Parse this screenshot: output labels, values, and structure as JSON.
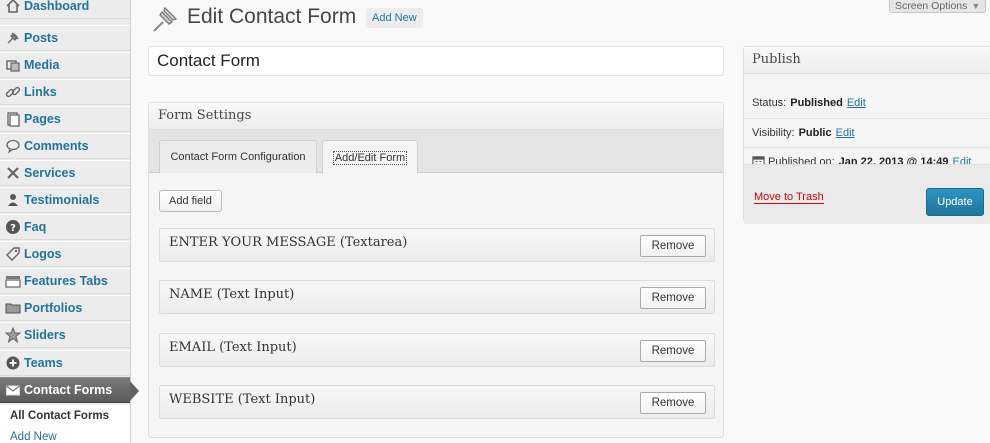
{
  "sidebar": {
    "items": [
      {
        "label": "Dashboard",
        "icon": "home-icon"
      },
      {
        "label": "Posts",
        "icon": "pushpin-icon"
      },
      {
        "label": "Media",
        "icon": "media-icon"
      },
      {
        "label": "Links",
        "icon": "link-icon"
      },
      {
        "label": "Pages",
        "icon": "pages-icon"
      },
      {
        "label": "Comments",
        "icon": "comment-icon"
      },
      {
        "label": "Services",
        "icon": "tools-icon"
      },
      {
        "label": "Testimonials",
        "icon": "user-icon"
      },
      {
        "label": "Faq",
        "icon": "question-icon"
      },
      {
        "label": "Logos",
        "icon": "tag-icon"
      },
      {
        "label": "Features Tabs",
        "icon": "tabs-icon"
      },
      {
        "label": "Portfolios",
        "icon": "folder-icon"
      },
      {
        "label": "Sliders",
        "icon": "star-icon"
      },
      {
        "label": "Teams",
        "icon": "plus-circle-icon"
      },
      {
        "label": "Contact Forms",
        "icon": "envelope-icon",
        "current": true
      }
    ],
    "submenu": [
      {
        "label": "All Contact Forms"
      },
      {
        "label": "Add New"
      }
    ]
  },
  "header": {
    "title": "Edit Contact Form",
    "add_new_label": "Add New",
    "screen_options_label": "Screen Options"
  },
  "title_field": {
    "value": "Contact Form"
  },
  "form_settings": {
    "title": "Form Settings",
    "tabs": [
      {
        "label": "Contact Form Configuration",
        "active": false
      },
      {
        "label": "Add/Edit Form",
        "active": true
      }
    ],
    "add_field_label": "Add field",
    "fields": [
      {
        "label": "ENTER YOUR MESSAGE (Textarea)",
        "remove_label": "Remove"
      },
      {
        "label": "NAME (Text Input)",
        "remove_label": "Remove"
      },
      {
        "label": "EMAIL (Text Input)",
        "remove_label": "Remove"
      },
      {
        "label": "WEBSITE (Text Input)",
        "remove_label": "Remove"
      }
    ]
  },
  "publish": {
    "title": "Publish",
    "status_label": "Status:",
    "status_value": "Published",
    "visibility_label": "Visibility:",
    "visibility_value": "Public",
    "published_on_label": "Published on:",
    "published_on_value": "Jan 22, 2013 @ 14:49",
    "edit_label": "Edit",
    "move_to_trash_label": "Move to Trash",
    "update_label": "Update"
  },
  "colors": {
    "link": "#21759b",
    "trash": "#bc0b0b",
    "update_button": "#21759b",
    "current_menu": "#626262"
  }
}
